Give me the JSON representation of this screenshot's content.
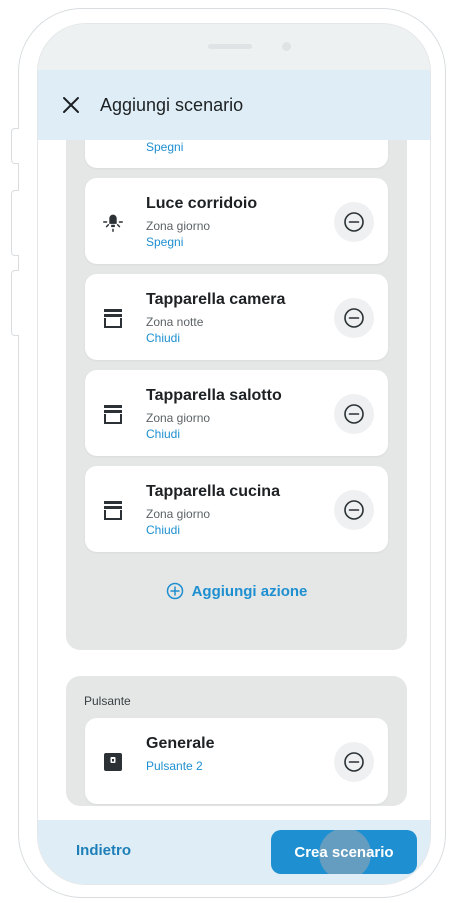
{
  "header": {
    "title": "Aggiungi scenario"
  },
  "actions": [
    {
      "action": "Spegni"
    },
    {
      "title": "Luce corridoio",
      "zone": "Zona giorno",
      "action": "Spegni",
      "icon": "light-bulb-icon"
    },
    {
      "title": "Tapparella camera",
      "zone": "Zona notte",
      "action": "Chiudi",
      "icon": "shutter-icon"
    },
    {
      "title": "Tapparella salotto",
      "zone": "Zona giorno",
      "action": "Chiudi",
      "icon": "shutter-icon"
    },
    {
      "title": "Tapparella cucina",
      "zone": "Zona giorno",
      "action": "Chiudi",
      "icon": "shutter-icon"
    }
  ],
  "add_action_label": "Aggiungi azione",
  "button_section": {
    "label": "Pulsante",
    "item": {
      "title": "Generale",
      "subtitle": "Pulsante 2",
      "icon": "wall-switch-icon"
    }
  },
  "footer": {
    "back_label": "Indietro",
    "create_label": "Crea scenario"
  },
  "colors": {
    "accent": "#1e8fd0",
    "header_bg": "#dfeef6",
    "group_bg": "#e5e7e7"
  }
}
